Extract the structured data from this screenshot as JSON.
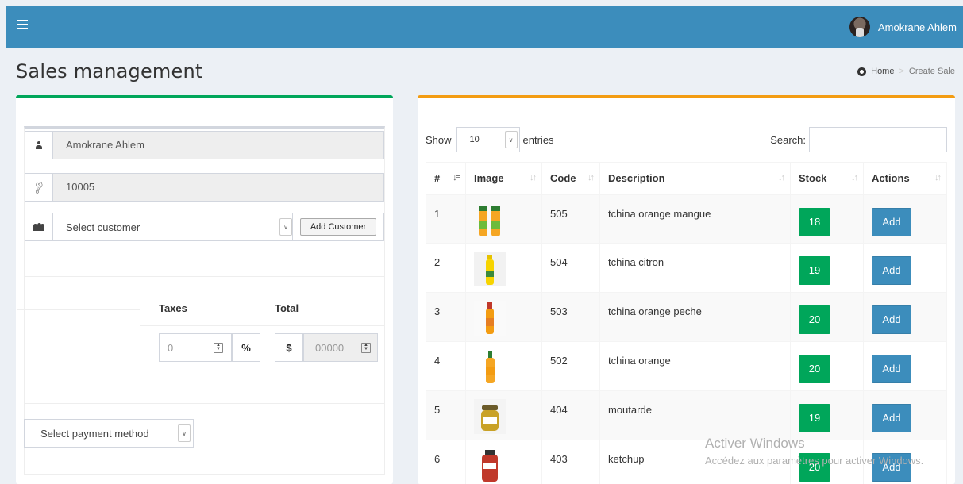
{
  "topbar": {
    "user_name": "Amokrane Ahlem"
  },
  "page": {
    "title": "Sales management"
  },
  "breadcrumb": {
    "home": "Home",
    "sep": ">",
    "current": "Create Sale"
  },
  "form": {
    "seller": "Amokrane Ahlem",
    "code": "10005",
    "customer_select": "Select customer",
    "add_customer": "Add Customer",
    "taxes_label": "Taxes",
    "total_label": "Total",
    "taxes_value": "0",
    "percent_symbol": "%",
    "currency_symbol": "$",
    "total_value": "00000",
    "payment_select": "Select payment method"
  },
  "table_controls": {
    "show": "Show",
    "entries_value": "10",
    "entries": "entries",
    "search": "Search:"
  },
  "table": {
    "headers": [
      "#",
      "Image",
      "Code",
      "Description",
      "Stock",
      "Actions"
    ],
    "rows": [
      {
        "num": "1",
        "code": "505",
        "description": "tchina orange mangue",
        "stock": "18",
        "action": "Add"
      },
      {
        "num": "2",
        "code": "504",
        "description": "tchina citron",
        "stock": "19",
        "action": "Add"
      },
      {
        "num": "3",
        "code": "503",
        "description": "tchina orange peche",
        "stock": "20",
        "action": "Add"
      },
      {
        "num": "4",
        "code": "502",
        "description": "tchina orange",
        "stock": "20",
        "action": "Add"
      },
      {
        "num": "5",
        "code": "404",
        "description": "moutarde",
        "stock": "19",
        "action": "Add"
      },
      {
        "num": "6",
        "code": "403",
        "description": "ketchup",
        "stock": "20",
        "action": "Add"
      }
    ]
  },
  "watermark": {
    "line1": "Activer Windows",
    "line2": "Accédez aux paramètres pour activer Windows."
  },
  "colors": {
    "topbar": "#3c8dbc",
    "stock_badge": "#00a65a",
    "add_button": "#3c8dbc",
    "left_box_border": "#00a65a",
    "right_box_border": "#f39c12"
  }
}
